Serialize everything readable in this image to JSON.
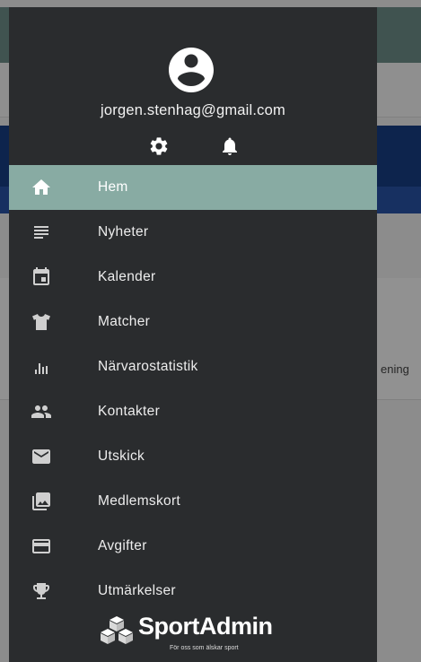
{
  "background": {
    "partial_text": "ening"
  },
  "drawer": {
    "user": {
      "email": "jorgen.stenhag@gmail.com",
      "avatar_icon": "account-circle-icon"
    },
    "header_icons": [
      "gear-icon",
      "bell-icon"
    ],
    "menu": [
      {
        "label": "Hem",
        "icon": "home-icon",
        "active": true
      },
      {
        "label": "Nyheter",
        "icon": "notes-icon",
        "active": false
      },
      {
        "label": "Kalender",
        "icon": "calendar-icon",
        "active": false
      },
      {
        "label": "Matcher",
        "icon": "shirt-icon",
        "active": false
      },
      {
        "label": "Närvarostatistik",
        "icon": "bar-chart-icon",
        "active": false
      },
      {
        "label": "Kontakter",
        "icon": "people-icon",
        "active": false
      },
      {
        "label": "Utskick",
        "icon": "mail-icon",
        "active": false
      },
      {
        "label": "Medlemskort",
        "icon": "photo-card-icon",
        "active": false
      },
      {
        "label": "Avgifter",
        "icon": "credit-card-icon",
        "active": false
      },
      {
        "label": "Utmärkelser",
        "icon": "trophy-icon",
        "active": false
      }
    ],
    "logo": {
      "name": "SportAdmin",
      "tagline": "För oss som älskar sport"
    }
  },
  "colors": {
    "drawer_bg": "#2a2c2e",
    "active_item_bg": "#88aba3",
    "app_header_teal": "#6f8f8a",
    "app_blue": "#173f86"
  }
}
